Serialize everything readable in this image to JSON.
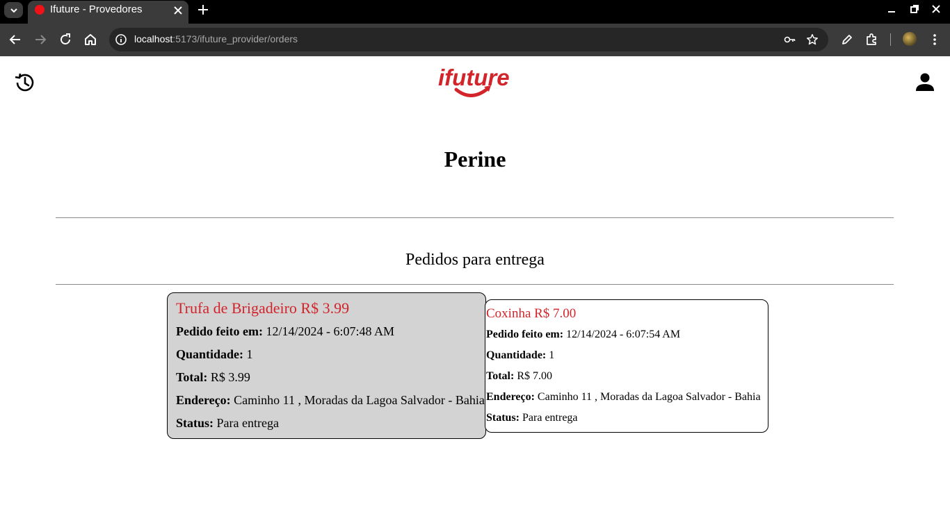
{
  "browser": {
    "tab_title": "Ifuture - Provedores",
    "url_host": "localhost",
    "url_rest": ":5173/ifuture_provider/orders"
  },
  "colors": {
    "brand_red": "#d2242b",
    "card_active_bg": "#d3d3d3"
  },
  "header": {
    "logo_text": "ifuture",
    "left_icon": "history-icon",
    "right_icon": "user-icon"
  },
  "provider": {
    "name": "Perine"
  },
  "section": {
    "title": "Pedidos para entrega"
  },
  "labels": {
    "ordered_at": "Pedido feito em:",
    "quantity": "Quantidade:",
    "total": "Total:",
    "address": "Endereço:",
    "status": "Status:"
  },
  "orders": [
    {
      "title": "Trufa de Brigadeiro R$ 3.99",
      "ordered_at": "12/14/2024 - 6:07:48 AM",
      "quantity": "1",
      "total": "R$ 3.99",
      "address": "Caminho 11 , Moradas da Lagoa Salvador - Bahia",
      "status": "Para entrega"
    },
    {
      "title": "Coxinha R$ 7.00",
      "ordered_at": "12/14/2024 - 6:07:54 AM",
      "quantity": "1",
      "total": "R$ 7.00",
      "address": "Caminho 11 , Moradas da Lagoa Salvador - Bahia",
      "status": "Para entrega"
    }
  ]
}
